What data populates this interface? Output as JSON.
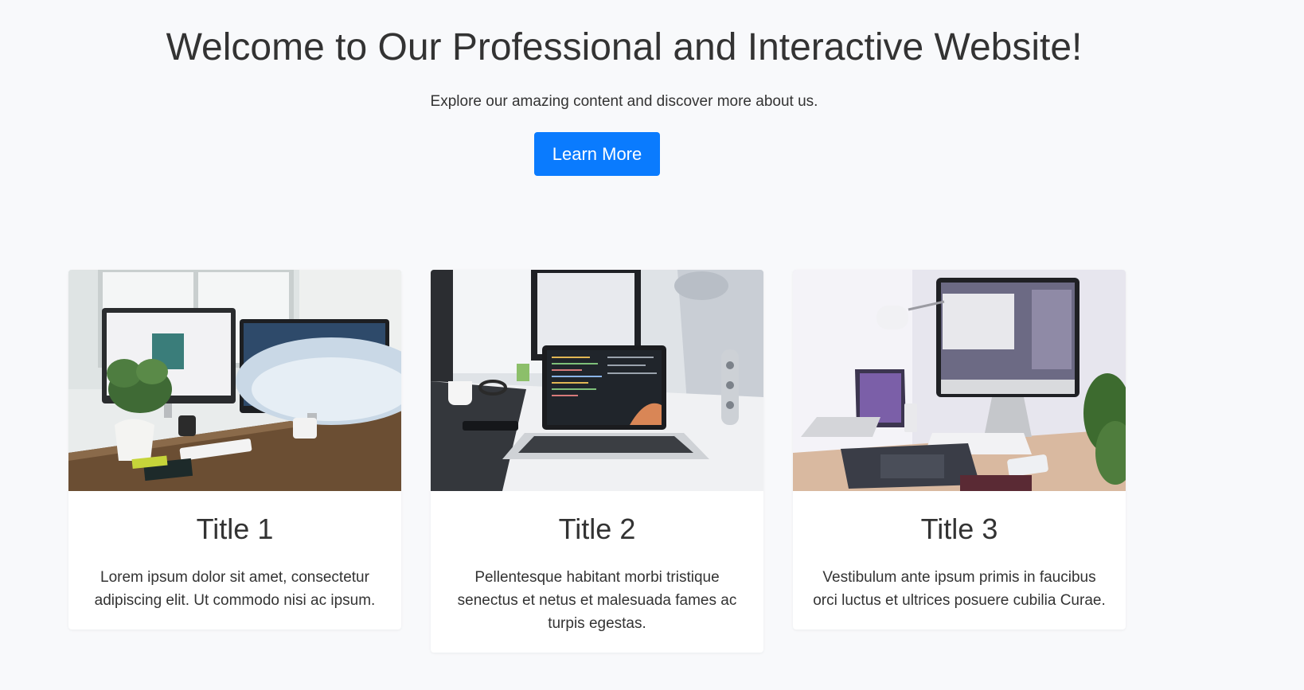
{
  "hero": {
    "title": "Welcome to Our Professional and Interactive Website!",
    "subtitle": "Explore our amazing content and discover more about us.",
    "cta_label": "Learn More"
  },
  "colors": {
    "background": "#f8f9fb",
    "accent": "#0a7bfe",
    "card": "#ffffff",
    "text": "#333333"
  },
  "cards": [
    {
      "title": "Title 1",
      "text": "Lorem ipsum dolor sit amet, consectetur adipiscing elit. Ut commodo nisi ac ipsum."
    },
    {
      "title": "Title 2",
      "text": "Pellentesque habitant morbi tristique senectus et netus et malesuada fames ac turpis egestas."
    },
    {
      "title": "Title 3",
      "text": "Vestibulum ante ipsum primis in faucibus orci luctus et ultrices posuere cubilia Curae."
    }
  ]
}
